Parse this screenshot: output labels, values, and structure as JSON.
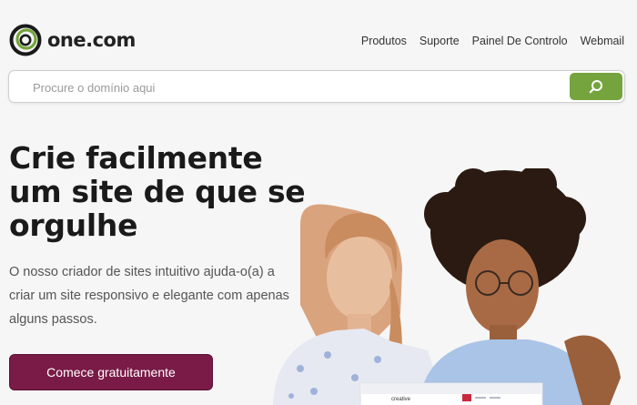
{
  "brand": {
    "name": "one.com",
    "green": "#75a43e",
    "accent": "#7a1b47"
  },
  "nav": {
    "items": [
      {
        "label": "Produtos"
      },
      {
        "label": "Suporte"
      },
      {
        "label": "Painel De Controlo"
      },
      {
        "label": "Webmail"
      }
    ]
  },
  "search": {
    "placeholder": "Procure o domínio aqui",
    "value": "",
    "icon": "search-icon"
  },
  "hero": {
    "title": "Crie facilmente um site de que se orgulhe",
    "subtitle": "O nosso criador de sites intuitivo ajuda-o(a) a criar um site responsivo e elegante com apenas alguns passos.",
    "cta_label": "Comece gratuitamente"
  },
  "photo": {
    "screen_label": "creative"
  }
}
